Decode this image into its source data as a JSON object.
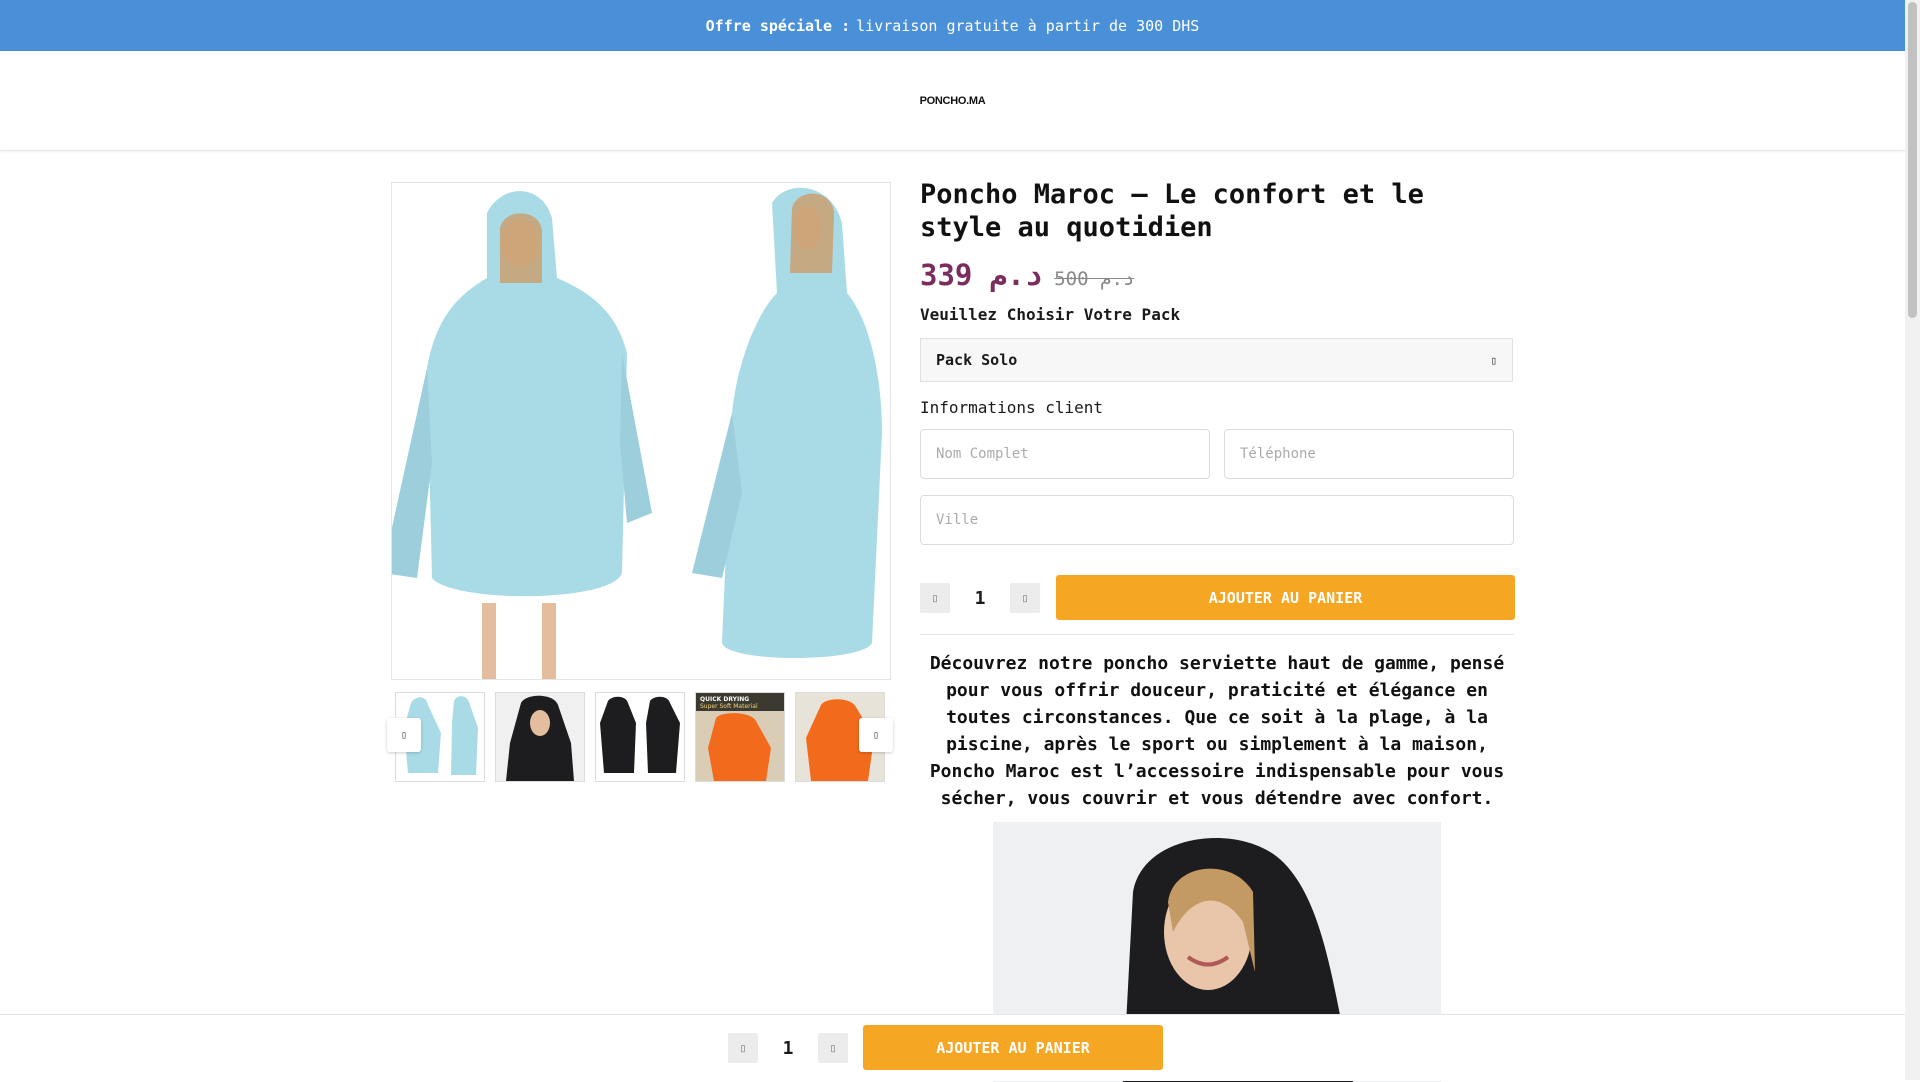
{
  "announcement": {
    "bold": "Offre spéciale :",
    "text": "livraison gratuite à partir de 300 DHS"
  },
  "header": {
    "logo": "PONCHO.MA"
  },
  "product": {
    "title": "Poncho Maroc – Le confort et le style au quotidien",
    "price_new": "339 د.م",
    "price_old": "500 د.م",
    "pack_label": "Veuillez Choisir Votre Pack",
    "pack_selected": "Pack Solo",
    "info_label": "Informations client",
    "fields": {
      "name_placeholder": "Nom Complet",
      "phone_placeholder": "Téléphone",
      "city_placeholder": "Ville"
    },
    "quantity": "1",
    "add_to_cart": "AJOUTER AU PANIER",
    "description": "Découvrez notre poncho serviette haut de gamme, pensé pour vous offrir douceur, praticité et élégance en toutes circonstances. Que ce soit à la plage, à la piscine, après le sport ou simplement à la maison, Poncho Maroc est l’accessoire indispensable pour vous sécher, vous couvrir et vous détendre avec confort."
  },
  "gallery": {
    "thumbnails": [
      "light-blue-poncho",
      "black-poncho-hood",
      "black-poncho-pair",
      "orange-poncho-quick-drying",
      "orange-poncho"
    ],
    "thumb3_caption": "QUICK DRYING Super Soft Material"
  },
  "sticky_bar": {
    "quantity": "1",
    "add_to_cart": "AJOUTER AU PANIER"
  },
  "colors": {
    "announcement_bg": "#4a90d9",
    "price": "#7b2d5e",
    "button": "#f5a623",
    "poncho_blue": "#a9dbe6",
    "poncho_black": "#1d1d1f",
    "poncho_orange": "#f26a1b"
  }
}
